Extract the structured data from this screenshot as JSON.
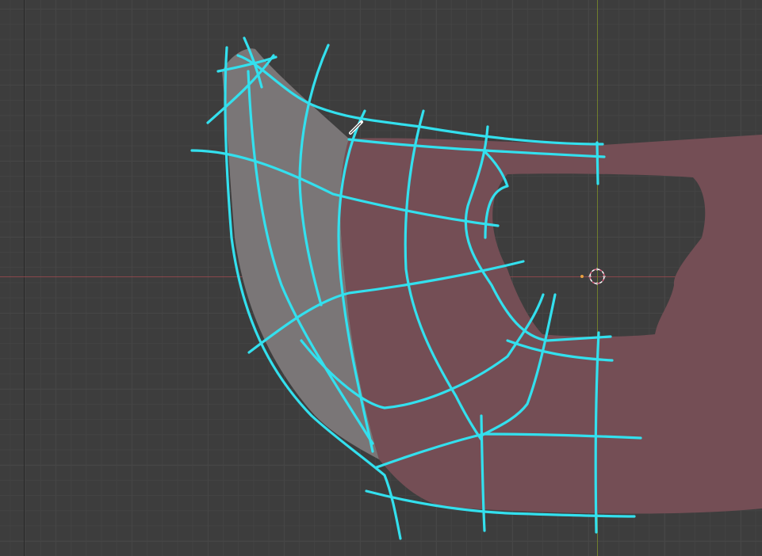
{
  "app": {
    "mode": "draw-annotation",
    "active_tool": "annotate"
  },
  "colors": {
    "background": "#3d3d3d",
    "grid_major": "#464646",
    "grid_minor": "#434343",
    "x_axis": "#9c4a4f",
    "y_axis": "#7a8a2a",
    "mesh_red": "#744e55",
    "mesh_grey": "#7a7677",
    "stroke": "#33e0ee",
    "cursor_ring": "#e88aa0"
  },
  "icons": {
    "cursor": "3d-cursor-icon",
    "pen": "pencil-cursor-icon"
  }
}
